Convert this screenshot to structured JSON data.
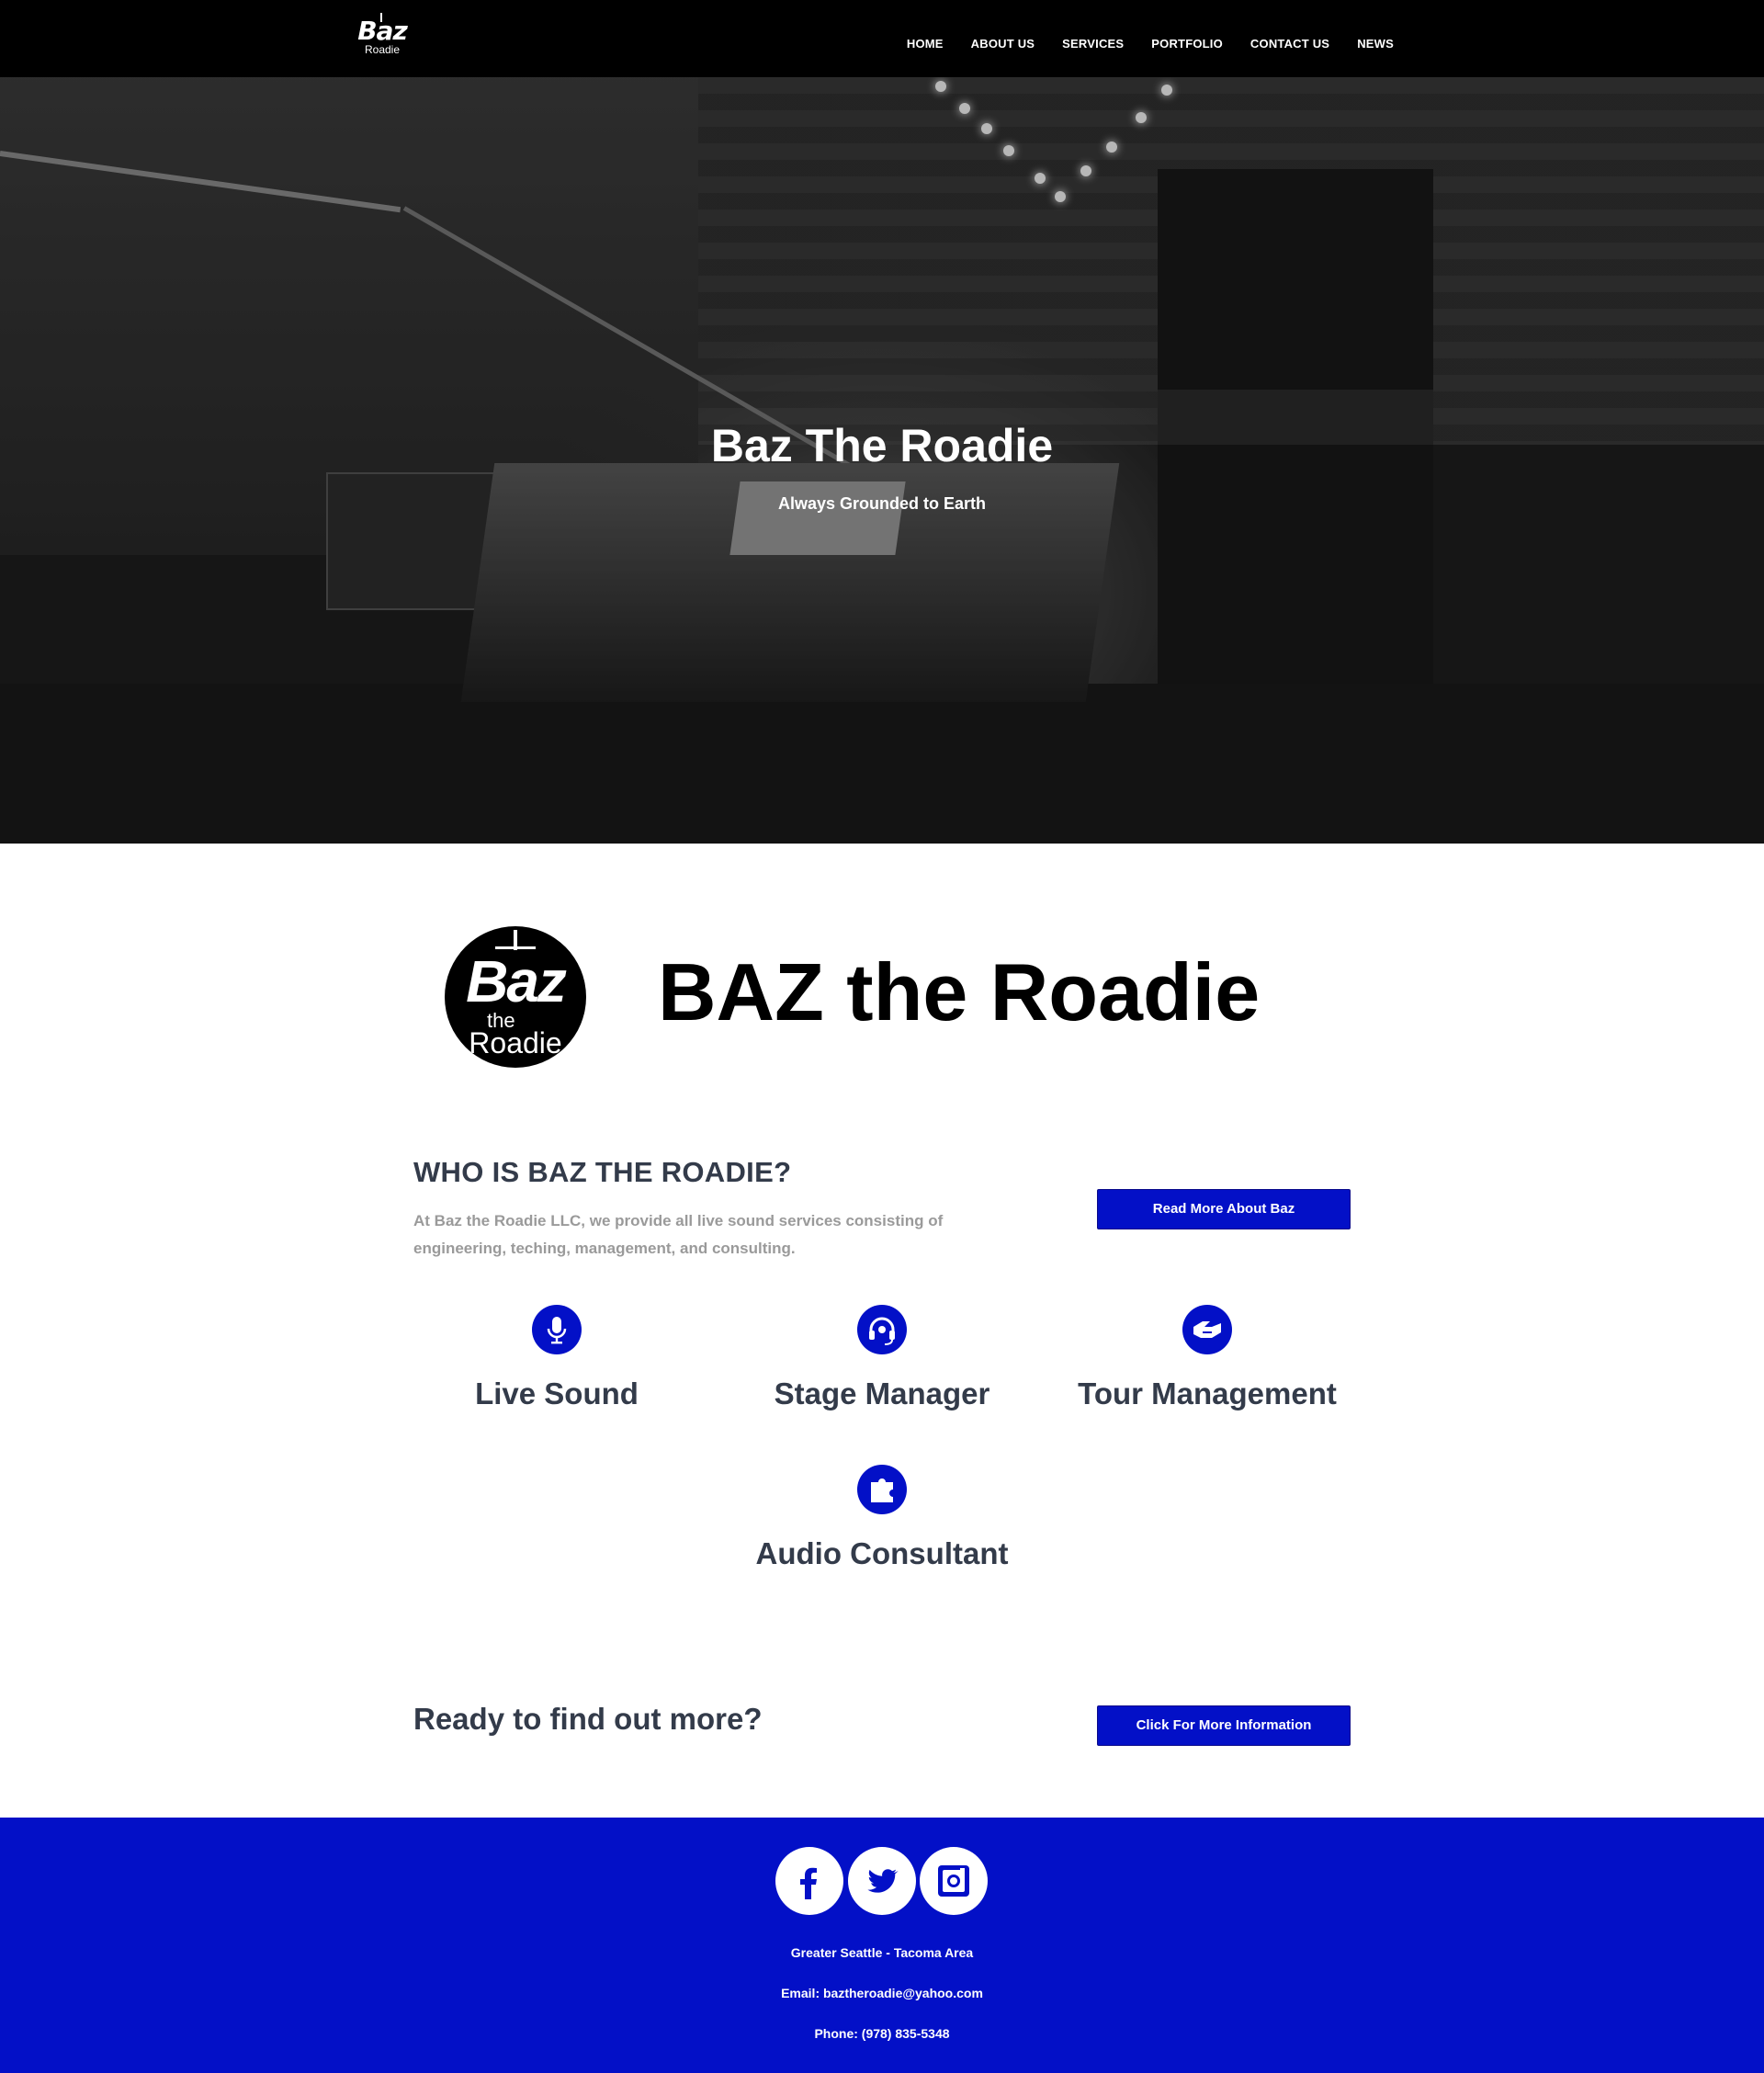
{
  "nav": {
    "logo_main": "Baz",
    "logo_sub": "Roadie",
    "items": [
      "HOME",
      "ABOUT US",
      "SERVICES",
      "PORTFOLIO",
      "CONTACT US",
      "NEWS"
    ]
  },
  "hero": {
    "title": "Baz The Roadie",
    "tagline": "Always Grounded to Earth"
  },
  "brand": {
    "logo_top": "Baz",
    "logo_mid": "the",
    "logo_bottom": "Roadie",
    "title": "BAZ the Roadie"
  },
  "who": {
    "heading": "WHO IS BAZ THE ROADIE?",
    "text": "At Baz the Roadie LLC, we provide all live sound services consisting of engineering, teching, management, and consulting.",
    "button": "Read More About Baz"
  },
  "services": [
    {
      "label": "Live Sound",
      "icon": "microphone-icon"
    },
    {
      "label": "Stage Manager",
      "icon": "headset-icon"
    },
    {
      "label": "Tour Management",
      "icon": "handshake-icon"
    },
    {
      "label": "Audio Consultant",
      "icon": "puzzle-icon"
    }
  ],
  "cta": {
    "text": "Ready to find out more?",
    "button": "Click For More Information"
  },
  "footer": {
    "location": "Greater Seattle - Tacoma Area",
    "email": "Email: baztheroadie@yahoo.com",
    "phone": "Phone: (978) 835-5348",
    "social": [
      "facebook-icon",
      "twitter-icon",
      "instagram-icon"
    ]
  },
  "colors": {
    "accent": "#0310c7",
    "nav_bg": "#000000",
    "heading": "#333b4a",
    "muted": "#9a9a9a"
  }
}
